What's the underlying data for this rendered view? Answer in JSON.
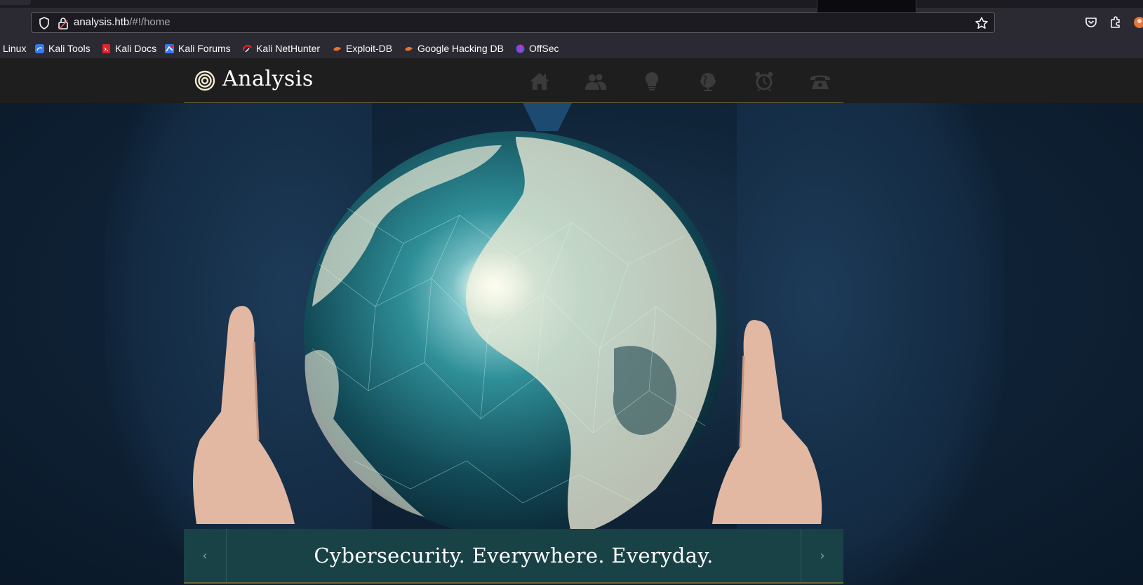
{
  "browser": {
    "url_host": "analysis.htb",
    "url_path": "/#!/home",
    "bookmarks": [
      {
        "label": "Linux",
        "icon": "folder-icon"
      },
      {
        "label": "Kali Tools",
        "icon": "kali-tools-icon"
      },
      {
        "label": "Kali Docs",
        "icon": "kali-docs-icon"
      },
      {
        "label": "Kali Forums",
        "icon": "kali-forums-icon"
      },
      {
        "label": "Kali NetHunter",
        "icon": "kali-nethunter-icon"
      },
      {
        "label": "Exploit-DB",
        "icon": "exploit-db-icon"
      },
      {
        "label": "Google Hacking DB",
        "icon": "google-hacking-db-icon"
      },
      {
        "label": "OffSec",
        "icon": "offsec-icon"
      }
    ]
  },
  "site": {
    "brand": "Analysis",
    "nav": [
      "home-icon",
      "team-icon",
      "lightbulb-icon",
      "globe-icon",
      "alarm-clock-icon",
      "phone-icon"
    ]
  },
  "hero": {
    "caption": "Cybersecurity. Everywhere. Everyday.",
    "prev_glyph": "‹",
    "next_glyph": "›"
  },
  "colors": {
    "header_bg": "#1e1e1e",
    "caption_bg": "#184246",
    "accent_line": "#6f6a3c",
    "hero_bg": "#102438"
  }
}
